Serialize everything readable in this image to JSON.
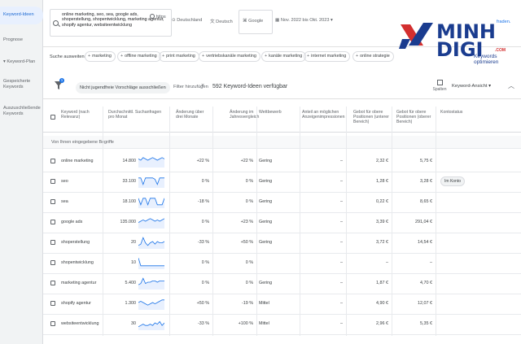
{
  "sidebar": {
    "items": [
      {
        "label": "Keyword-Ideen",
        "active": true
      },
      {
        "label": "Prognose"
      },
      {
        "label": "▾ Keyword-Plan"
      },
      {
        "label": "Gespeicherte Keywords"
      },
      {
        "label": "Auszuschließende Keywords"
      }
    ]
  },
  "header": {
    "keywords": "online marketing, seo, sea, google ads, shoperstellung, shopentwicklung, marketing agentur, shopify agentur, websiteentwicklung",
    "url_hint": "https",
    "location": "Deutschland",
    "language": "Deutsch",
    "network": "Google",
    "date_range": "Nov. 2022 bis Okt. 2023",
    "overflow_link": "fraden."
  },
  "logo": {
    "text": "MINH DIGI",
    "domain": ".COM",
    "tagline": "Keywords optimieren"
  },
  "chips": {
    "label": "Suche ausweiten:",
    "items": [
      "marketing",
      "offline marketing",
      "print marketing",
      "vertriebskanäle marketing",
      "kanäle marketing",
      "internet marketing",
      "online strategie"
    ]
  },
  "filterbar": {
    "filter_count": "1",
    "active_filter": "Nicht jugendfreie Vorschläge ausschließen",
    "add_filter": "Filter hinzufügen",
    "idea_count": "592 Keyword-Ideen verfügbar",
    "columns_label": "Spalten",
    "view_label": "Keyword-Ansicht ▾"
  },
  "table": {
    "headers": {
      "keyword": "Keyword (nach Relevanz)",
      "avg": "Durchschnittl. Suchanfragen pro Monat",
      "change3": "Änderung über drei Monate",
      "changeyoy": "Änderung im Jahresvergleich",
      "competition": "Wettbewerb",
      "share": "Anteil an möglichen Anzeigenimpressionen",
      "bid_low": "Gebot für obere Positionen (unterer Bereich)",
      "bid_high": "Gebot für obere Positionen (oberer Bereich)",
      "status": "Kontostatus"
    },
    "group_label": "Von Ihnen eingegebene Begriffe",
    "rows": [
      {
        "keyword": "online marketing",
        "avg": "14.800",
        "change3": "+22 %",
        "changeyoy": "+22 %",
        "competition": "Gering",
        "share": "–",
        "bid_low": "2,32 €",
        "bid_high": "5,75 €",
        "status": "",
        "trend": [
          6,
          5,
          7,
          6,
          5,
          6,
          7,
          6,
          5,
          6,
          7,
          6
        ]
      },
      {
        "keyword": "seo",
        "avg": "33.100",
        "change3": "0 %",
        "changeyoy": "0 %",
        "competition": "Gering",
        "share": "–",
        "bid_low": "1,28 €",
        "bid_high": "3,28 €",
        "status": "Im Konto",
        "trend": [
          7,
          7,
          2,
          7,
          7,
          7,
          7,
          6,
          2,
          7,
          7,
          7
        ]
      },
      {
        "keyword": "sea",
        "avg": "18.100",
        "change3": "-18 %",
        "changeyoy": "0 %",
        "competition": "Gering",
        "share": "–",
        "bid_low": "0,22 €",
        "bid_high": "8,65 €",
        "status": "",
        "trend": [
          7,
          2,
          7,
          7,
          2,
          7,
          7,
          7,
          2,
          2,
          2,
          7
        ]
      },
      {
        "keyword": "google ads",
        "avg": "135.000",
        "change3": "0 %",
        "changeyoy": "+23 %",
        "competition": "Gering",
        "share": "–",
        "bid_low": "3,39 €",
        "bid_high": "291,04 €",
        "status": "",
        "trend": [
          4,
          5,
          6,
          5,
          6,
          7,
          6,
          5,
          6,
          5,
          6,
          7
        ]
      },
      {
        "keyword": "shoperstellung",
        "avg": "20",
        "change3": "-33 %",
        "changeyoy": "+50 %",
        "competition": "Gering",
        "share": "–",
        "bid_low": "3,72 €",
        "bid_high": "14,54 €",
        "status": "",
        "trend": [
          2,
          3,
          8,
          4,
          2,
          4,
          5,
          3,
          5,
          4,
          4,
          5
        ]
      },
      {
        "keyword": "shopentwicklung",
        "avg": "10",
        "change3": "0 %",
        "changeyoy": "0 %",
        "competition": "",
        "share": "–",
        "bid_low": "–",
        "bid_high": "–",
        "status": "",
        "trend": [
          8,
          2,
          2,
          2,
          2,
          2,
          2,
          2,
          2,
          2,
          2,
          2
        ]
      },
      {
        "keyword": "marketing agentur",
        "avg": "5.400",
        "change3": "0 %",
        "changeyoy": "0 %",
        "competition": "Gering",
        "share": "–",
        "bid_low": "1,87 €",
        "bid_high": "4,70 €",
        "status": "",
        "trend": [
          3,
          4,
          8,
          4,
          5,
          5,
          6,
          6,
          5,
          6,
          6,
          6
        ]
      },
      {
        "keyword": "shopify agentur",
        "avg": "1.300",
        "change3": "+50 %",
        "changeyoy": "-19 %",
        "competition": "Mittel",
        "share": "–",
        "bid_low": "4,90 €",
        "bid_high": "12,07 €",
        "status": "",
        "trend": [
          5,
          6,
          5,
          4,
          3,
          4,
          5,
          4,
          5,
          6,
          7,
          7
        ]
      },
      {
        "keyword": "websiteentwicklung",
        "avg": "30",
        "change3": "-33 %",
        "changeyoy": "+100 %",
        "competition": "Mittel",
        "share": "–",
        "bid_low": "2,96 €",
        "bid_high": "5,35 €",
        "status": "",
        "trend": [
          2,
          3,
          4,
          3,
          3,
          4,
          3,
          5,
          4,
          6,
          3,
          5
        ]
      }
    ]
  }
}
